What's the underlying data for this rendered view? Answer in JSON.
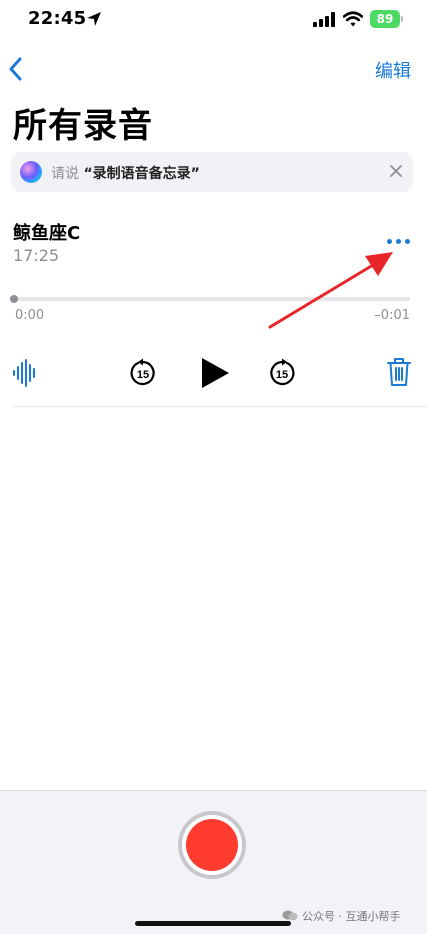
{
  "status_bar": {
    "time": "22:45",
    "battery": "89"
  },
  "nav": {
    "edit_label": "编辑"
  },
  "page": {
    "title": "所有录音"
  },
  "siri_suggestion": {
    "prefix": "请说",
    "phrase": "“录制语音备忘录”"
  },
  "recording": {
    "title": "鲸鱼座C",
    "time": "17:25",
    "elapsed": "0:00",
    "remaining": "–0:01",
    "skip_back_seconds": "15",
    "skip_forward_seconds": "15",
    "progress": 0
  },
  "watermark": {
    "text": "公众号 · 互通小帮手"
  },
  "colors": {
    "accent": "#1a7ad6",
    "record": "#ff3b30",
    "battery": "#4cd964",
    "annotation_arrow": "#e8262a"
  },
  "icons": [
    "location-arrow-icon",
    "signal-icon",
    "wifi-icon",
    "back-chevron-icon",
    "siri-icon",
    "close-icon",
    "more-icon",
    "waveform-icon",
    "skip-back-icon",
    "play-icon",
    "skip-forward-icon",
    "trash-icon",
    "record-icon",
    "wechat-icon"
  ]
}
